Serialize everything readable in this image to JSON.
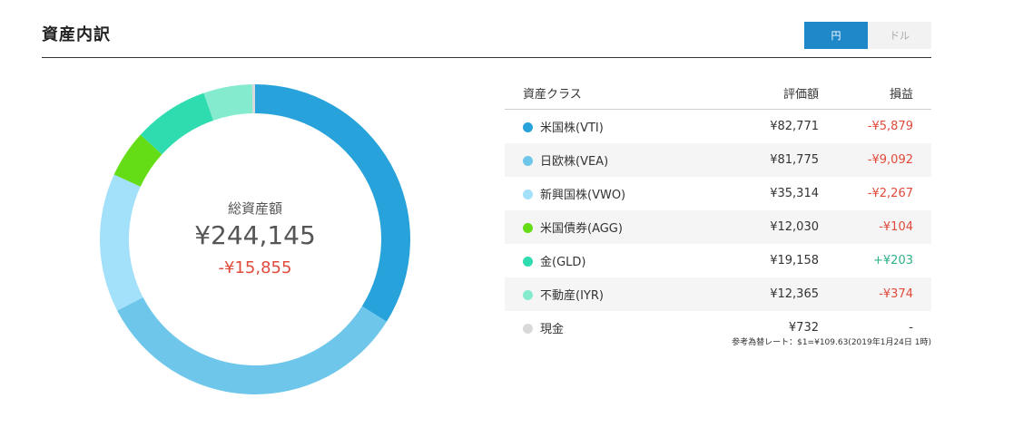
{
  "header": {
    "title": "資産内訳"
  },
  "currency_toggle": {
    "yen": "円",
    "dollar": "ドル",
    "active": "yen"
  },
  "summary": {
    "label": "総資産額",
    "total": "¥244,145",
    "diff": "-¥15,855"
  },
  "table": {
    "headers": {
      "class": "資産クラス",
      "value": "評価額",
      "pnl": "損益"
    },
    "rows": [
      {
        "name": "米国株(VTI)",
        "value": "¥82,771",
        "pnl": "-¥5,879",
        "sign": "neg",
        "color": "#27a2db",
        "amount": 82771
      },
      {
        "name": "日欧株(VEA)",
        "value": "¥81,775",
        "pnl": "-¥9,092",
        "sign": "neg",
        "color": "#6ec7ea",
        "amount": 81775
      },
      {
        "name": "新興国株(VWO)",
        "value": "¥35,314",
        "pnl": "-¥2,267",
        "sign": "neg",
        "color": "#a3e0fa",
        "amount": 35314
      },
      {
        "name": "米国債券(AGG)",
        "value": "¥12,030",
        "pnl": "-¥104",
        "sign": "neg",
        "color": "#64dc16",
        "amount": 12030
      },
      {
        "name": "金(GLD)",
        "value": "¥19,158",
        "pnl": "+¥203",
        "sign": "pos",
        "color": "#2fdcb0",
        "amount": 19158
      },
      {
        "name": "不動産(IYR)",
        "value": "¥12,365",
        "pnl": "-¥374",
        "sign": "neg",
        "color": "#84ebcf",
        "amount": 12365
      },
      {
        "name": "現金",
        "value": "¥732",
        "pnl": "-",
        "sign": "none",
        "color": "#d9d9d9",
        "amount": 732
      }
    ]
  },
  "note": "参考為替レート：$1=¥109.63(2019年1月24日 1時)"
}
